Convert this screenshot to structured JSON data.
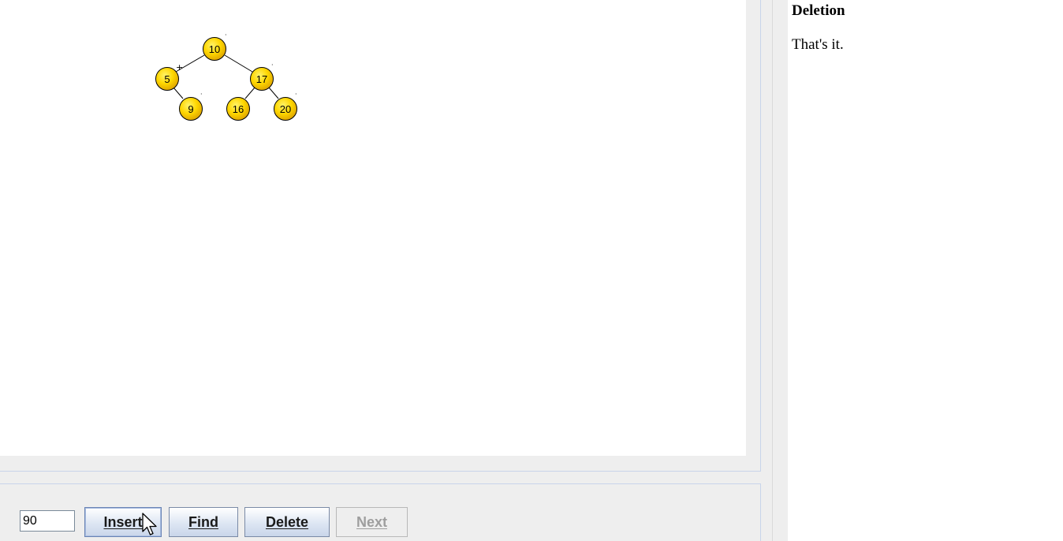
{
  "tree": {
    "nodes": [
      {
        "id": "n10",
        "label": "10"
      },
      {
        "id": "n5",
        "label": "5"
      },
      {
        "id": "n17",
        "label": "17"
      },
      {
        "id": "n9",
        "label": "9"
      },
      {
        "id": "n16",
        "label": "16"
      },
      {
        "id": "n20",
        "label": "20"
      }
    ],
    "node_color": "#ffd700",
    "edge_color": "#000000"
  },
  "controls": {
    "input_value": "90",
    "insert_label": "Insert",
    "find_label": "Find",
    "delete_label": "Delete",
    "next_label": "Next",
    "next_enabled": false
  },
  "help": {
    "title": "Deletion",
    "text": "That's it."
  }
}
